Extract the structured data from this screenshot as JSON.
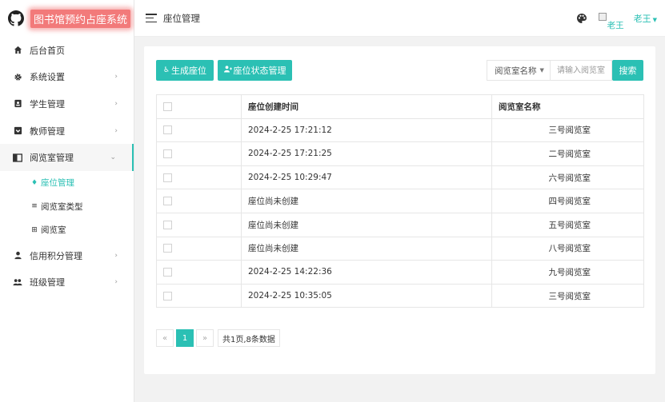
{
  "app": {
    "title": "图书馆预约占座系统"
  },
  "header": {
    "breadcrumb": "座位管理",
    "avatar_alt": "老王",
    "username": "老王"
  },
  "sidebar": {
    "items": [
      {
        "label": "后台首页",
        "icon": "home-icon"
      },
      {
        "label": "系统设置",
        "icon": "gear-icon"
      },
      {
        "label": "学生管理",
        "icon": "id-card-icon"
      },
      {
        "label": "教师管理",
        "icon": "teacher-icon"
      },
      {
        "label": "阅览室管理",
        "icon": "book-icon"
      },
      {
        "label": "信用积分管理",
        "icon": "user-icon"
      },
      {
        "label": "班级管理",
        "icon": "group-icon"
      }
    ],
    "subitems": [
      {
        "label": "座位管理",
        "icon": "seat-icon"
      },
      {
        "label": "阅览室类型",
        "icon": "list-icon"
      },
      {
        "label": "阅览室",
        "icon": "grid-icon"
      }
    ]
  },
  "toolbar": {
    "generate_label": "生成座位",
    "status_label": "座位状态管理",
    "select_label": "阅览室名称",
    "search_placeholder": "请输入阅览室",
    "search_label": "搜索"
  },
  "table": {
    "headers": [
      "",
      "座位创建时间",
      "阅览室名称"
    ],
    "rows": [
      {
        "created": "2024-2-25 17:21:12",
        "room": "三号阅览室"
      },
      {
        "created": "2024-2-25 17:21:25",
        "room": "二号阅览室"
      },
      {
        "created": "2024-2-25 10:29:47",
        "room": "六号阅览室"
      },
      {
        "created": "座位尚未创建",
        "room": "四号阅览室"
      },
      {
        "created": "座位尚未创建",
        "room": "五号阅览室"
      },
      {
        "created": "座位尚未创建",
        "room": "八号阅览室"
      },
      {
        "created": "2024-2-25 14:22:36",
        "room": "九号阅览室"
      },
      {
        "created": "2024-2-25 10:35:05",
        "room": "三号阅览室"
      }
    ]
  },
  "pagination": {
    "prev": "«",
    "current": "1",
    "next": "»",
    "info": "共1页,8条数据"
  },
  "colors": {
    "accent": "#2bc0b4",
    "logo_bg": "#f27a7a"
  }
}
